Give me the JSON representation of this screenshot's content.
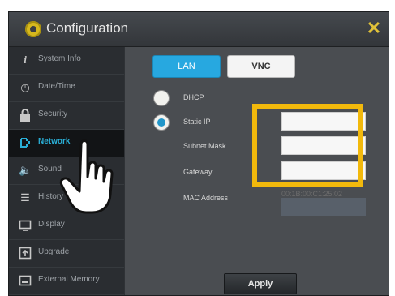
{
  "window": {
    "title": "Configuration",
    "close_label": "✕",
    "accent_color": "#e1c239"
  },
  "sidebar": {
    "items": [
      {
        "label": "System Info",
        "icon": "info-icon"
      },
      {
        "label": "Date/Time",
        "icon": "clock-icon"
      },
      {
        "label": "Security",
        "icon": "lock-icon"
      },
      {
        "label": "Network",
        "icon": "network-icon",
        "active": true
      },
      {
        "label": "Sound",
        "icon": "speaker-icon"
      },
      {
        "label": "History",
        "icon": "list-icon"
      },
      {
        "label": "Display",
        "icon": "monitor-icon"
      },
      {
        "label": "Upgrade",
        "icon": "upgrade-icon"
      },
      {
        "label": "External Memory",
        "icon": "memory-icon"
      }
    ],
    "active_color": "#2ab0d8"
  },
  "tabs": {
    "lan_label": "LAN",
    "vnc_label": "VNC",
    "active": "LAN"
  },
  "network": {
    "dhcp_label": "DHCP",
    "static_ip_label": "Static IP",
    "selected_mode": "Static IP",
    "subnet_mask_label": "Subnet Mask",
    "gateway_label": "Gateway",
    "mac_address_label": "MAC Address",
    "mac_address_value": "00:1B:00:C1:25:02",
    "static_ip_value": "",
    "subnet_mask_value": "",
    "gateway_value": ""
  },
  "apply_label": "Apply",
  "highlight_color": "#f2b90c"
}
